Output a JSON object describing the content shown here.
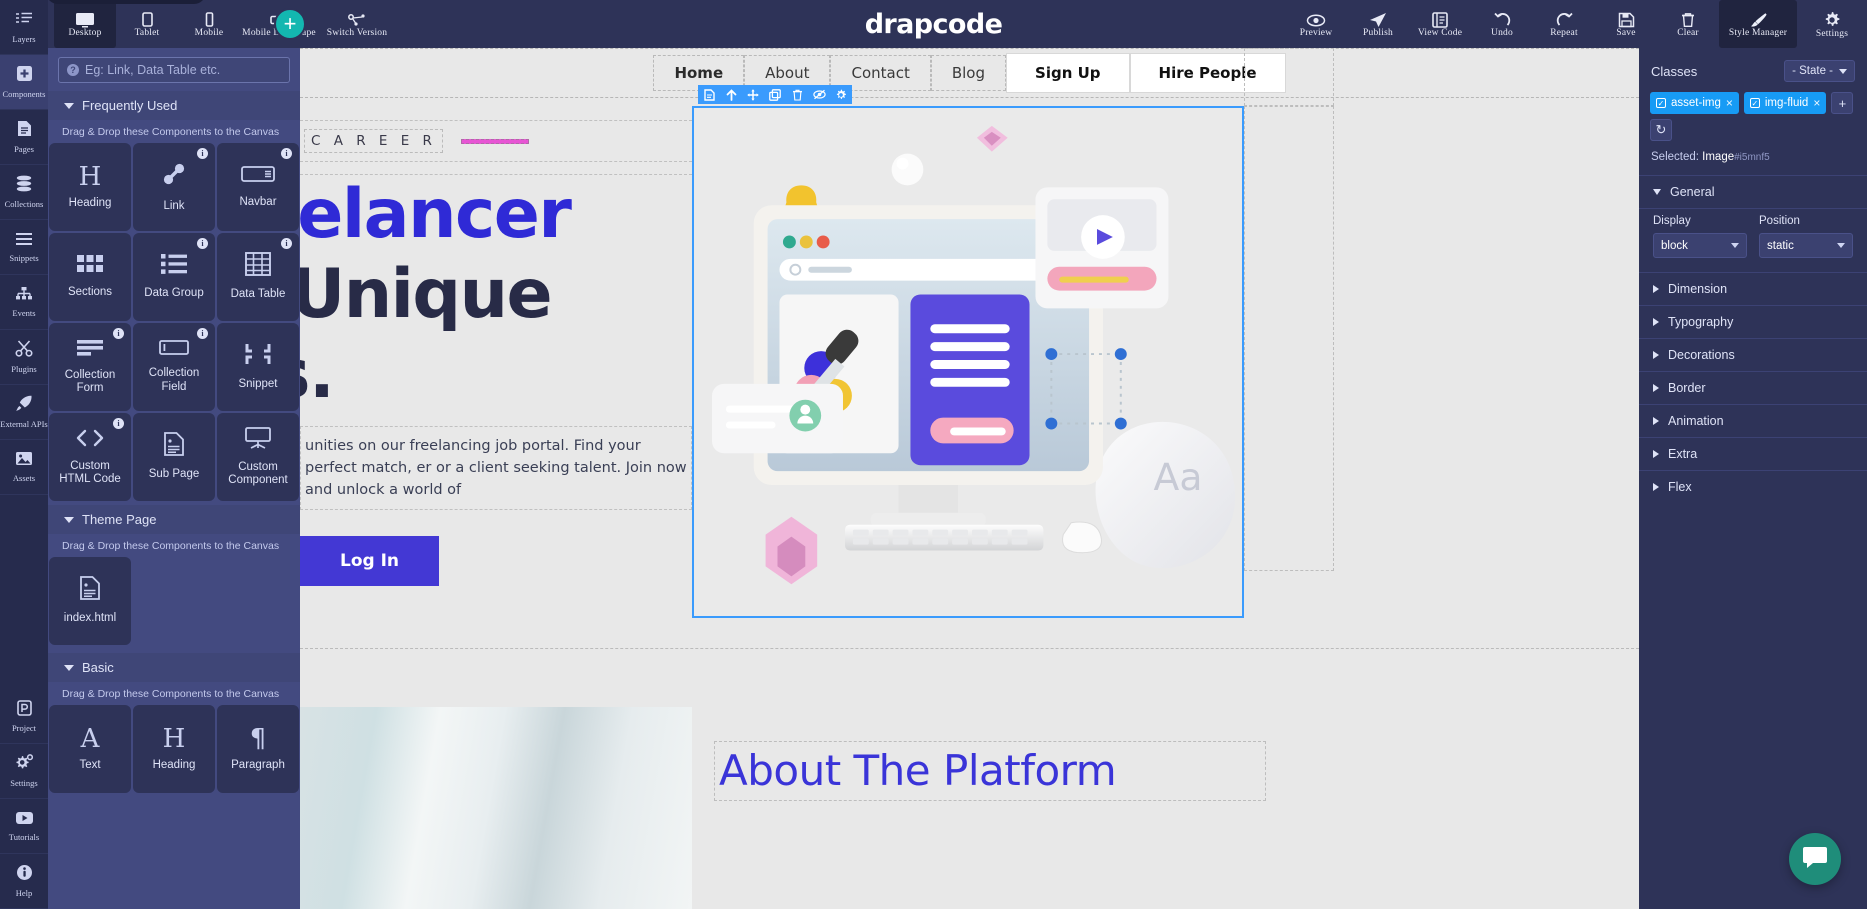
{
  "app": {
    "logo": "drapcode"
  },
  "topbar": {
    "devices": [
      {
        "label": "Desktop",
        "icon": "desktop-icon",
        "active": true
      },
      {
        "label": "Tablet",
        "icon": "tablet-icon",
        "active": false
      },
      {
        "label": "Mobile",
        "icon": "mobile-icon",
        "active": false
      },
      {
        "label": "Mobile Landscape",
        "icon": "mobile-landscape-icon",
        "active": false
      },
      {
        "label": "Switch Version",
        "icon": "switch-version-icon",
        "active": false
      }
    ],
    "actions": [
      {
        "label": "Preview",
        "icon": "eye-icon",
        "active": false
      },
      {
        "label": "Publish",
        "icon": "paper-plane-icon",
        "active": false
      },
      {
        "label": "View Code",
        "icon": "code-panel-icon",
        "active": false
      },
      {
        "label": "Undo",
        "icon": "undo-icon",
        "active": false
      },
      {
        "label": "Repeat",
        "icon": "redo-icon",
        "active": false
      },
      {
        "label": "Save",
        "icon": "floppy-disk-icon",
        "active": false
      },
      {
        "label": "Clear",
        "icon": "trash-icon",
        "active": false
      },
      {
        "label": "Style Manager",
        "icon": "paintbrush-icon",
        "active": true
      }
    ],
    "settings": {
      "label": "Settings",
      "icon": "gear-icon"
    },
    "add_button": "+"
  },
  "rail": {
    "items": [
      {
        "label": "Layers",
        "icon": "layers-icon",
        "active": false
      },
      {
        "label": "Components",
        "icon": "plus-square-icon",
        "active": true
      },
      {
        "label": "Pages",
        "icon": "page-icon",
        "active": false
      },
      {
        "label": "Collections",
        "icon": "database-icon",
        "active": false
      },
      {
        "label": "Snippets",
        "icon": "hamburger-icon",
        "active": false
      },
      {
        "label": "Events",
        "icon": "sitemap-icon",
        "active": false
      },
      {
        "label": "Plugins",
        "icon": "scissors-icon",
        "active": false
      },
      {
        "label": "External APIs",
        "icon": "rocket-icon",
        "active": false
      },
      {
        "label": "Assets",
        "icon": "image-icon",
        "active": false
      }
    ],
    "bottom_items": [
      {
        "label": "Project",
        "icon": "project-icon"
      },
      {
        "label": "Settings",
        "icon": "gears-icon"
      },
      {
        "label": "Tutorials",
        "icon": "video-icon"
      },
      {
        "label": "Help",
        "icon": "info-circle-icon"
      }
    ]
  },
  "components_panel": {
    "search_placeholder": "Eg: Link, Data Table etc.",
    "sections": [
      {
        "title": "Frequently Used",
        "hint": "Drag & Drop these Components to the Canvas",
        "items": [
          {
            "name": "Heading",
            "glyph": "H",
            "info": false
          },
          {
            "name": "Link",
            "glyph": "link",
            "info": true
          },
          {
            "name": "Navbar",
            "glyph": "navbar",
            "info": true
          },
          {
            "name": "Sections",
            "glyph": "grid",
            "info": false
          },
          {
            "name": "Data Group",
            "glyph": "list",
            "info": true
          },
          {
            "name": "Data Table",
            "glyph": "table",
            "info": true
          },
          {
            "name": "Collection Form",
            "glyph": "form",
            "info": true
          },
          {
            "name": "Collection Field",
            "glyph": "field",
            "info": true
          },
          {
            "name": "Snippet",
            "glyph": "corners",
            "info": false
          },
          {
            "name": "Custom HTML Code",
            "glyph": "code",
            "info": true
          },
          {
            "name": "Sub Page",
            "glyph": "file",
            "info": false
          },
          {
            "name": "Custom Component",
            "glyph": "easel",
            "info": false
          }
        ]
      },
      {
        "title": "Theme Page",
        "hint": "Drag & Drop these Components to the Canvas",
        "items": [
          {
            "name": "index.html",
            "glyph": "file",
            "info": false
          }
        ]
      },
      {
        "title": "Basic",
        "hint": "Drag & Drop these Components to the Canvas",
        "items": [
          {
            "name": "Text",
            "glyph": "A",
            "info": false
          },
          {
            "name": "Heading",
            "glyph": "H",
            "info": false
          },
          {
            "name": "Paragraph",
            "glyph": "P",
            "info": false
          }
        ]
      }
    ]
  },
  "canvas": {
    "nav": [
      {
        "label": "Home",
        "type": "active"
      },
      {
        "label": "About",
        "type": "plain"
      },
      {
        "label": "Contact",
        "type": "plain"
      },
      {
        "label": "Blog",
        "type": "plain"
      },
      {
        "label": "Sign Up",
        "type": "button"
      },
      {
        "label": "Hire People",
        "type": "button"
      }
    ],
    "hero": {
      "eyebrow": "C A R E E R",
      "title_line1": "Freelancer",
      "title_line2": "& Unique",
      "title_line3": "s.",
      "paragraph": "unities on our freelancing job portal. Find your perfect match, er or a client seeking talent. Join now and unlock a world of",
      "cta": "Log In"
    },
    "selection_toolbar": [
      {
        "icon": "page-select-icon"
      },
      {
        "icon": "arrow-up-icon"
      },
      {
        "icon": "move-icon"
      },
      {
        "icon": "copy-icon"
      },
      {
        "icon": "trash-icon"
      },
      {
        "icon": "eye-slash-icon"
      },
      {
        "icon": "gear-icon"
      }
    ],
    "lower": {
      "about_title": "About The Platform"
    }
  },
  "style_manager": {
    "classes_label": "Classes",
    "state_label": "- State -",
    "chips": [
      "asset-img",
      "img-fluid"
    ],
    "add_label": "+",
    "sync_label": "↻",
    "selected_label": "Selected:",
    "selected_value": "Image",
    "selected_id": "#i5mnf5",
    "sections": [
      {
        "title": "General",
        "open": true
      },
      {
        "title": "Dimension",
        "open": false
      },
      {
        "title": "Typography",
        "open": false
      },
      {
        "title": "Decorations",
        "open": false
      },
      {
        "title": "Border",
        "open": false
      },
      {
        "title": "Animation",
        "open": false
      },
      {
        "title": "Extra",
        "open": false
      },
      {
        "title": "Flex",
        "open": false
      }
    ],
    "general": {
      "display_label": "Display",
      "display_value": "block",
      "position_label": "Position",
      "position_value": "static"
    }
  },
  "colors": {
    "accent": "#179bf5",
    "brand": "#2f2ad6",
    "panel": "#2e3358",
    "chat": "#1f8d7a"
  }
}
